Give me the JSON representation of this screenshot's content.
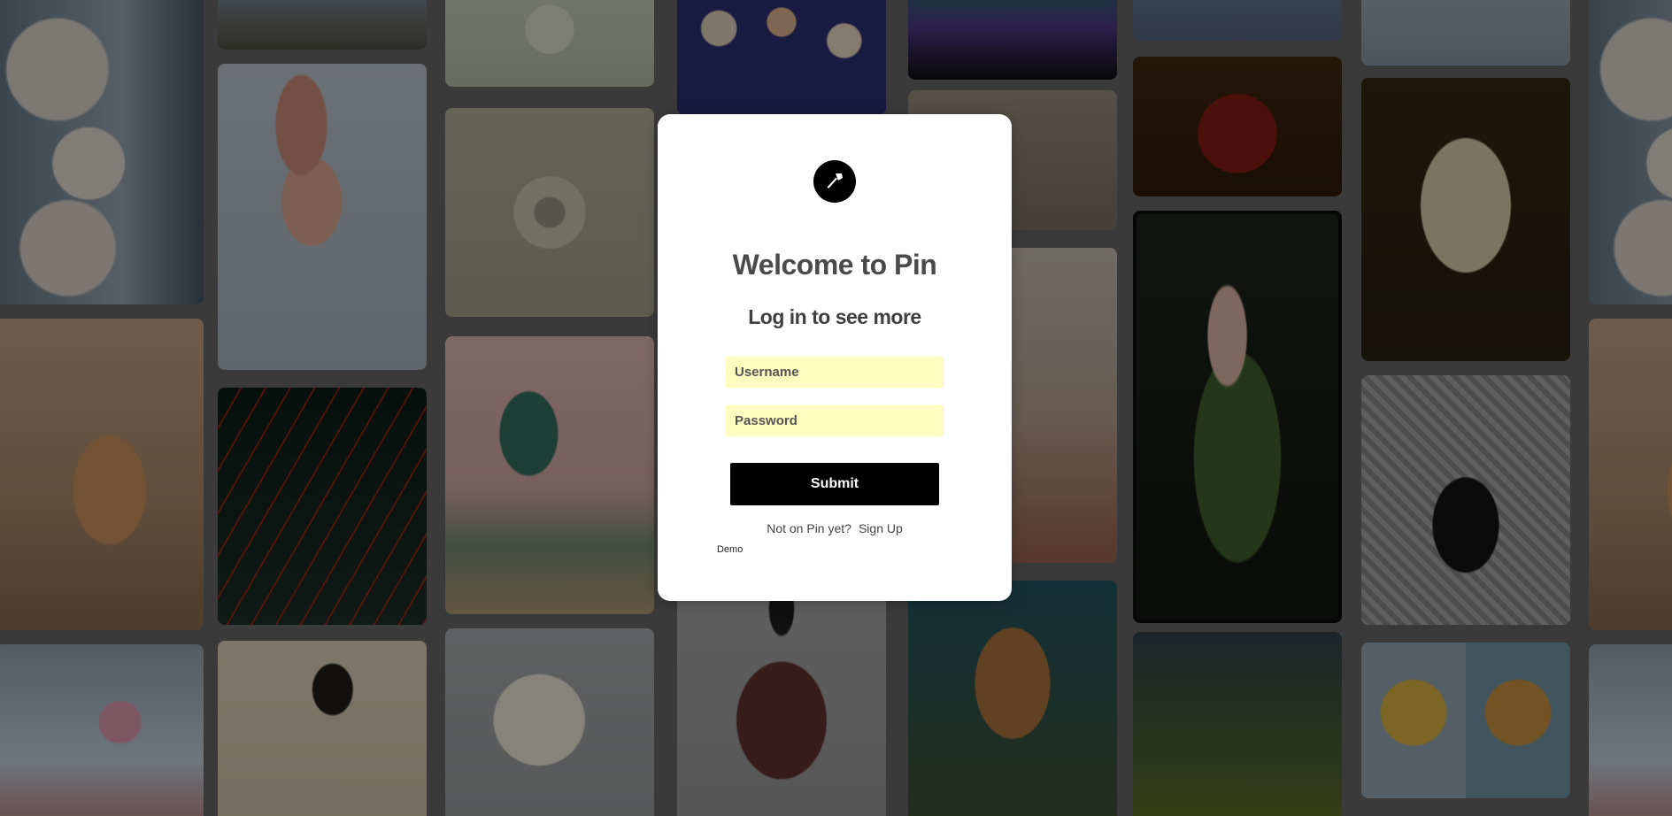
{
  "app": {
    "brand": "Pin"
  },
  "modal": {
    "logo_icon": "pin-hammer-icon",
    "title": "Welcome to Pin",
    "subtitle": "Log in to see more",
    "username_placeholder": "Username",
    "password_placeholder": "Password",
    "submit_label": "Submit",
    "signup_prompt": "Not on Pin yet?",
    "signup_link": "Sign Up",
    "demo_link": "Demo"
  },
  "background": {
    "overlay_color": "#000000",
    "tile_themes": [
      "ice-cream",
      "desert",
      "caracal",
      "drink",
      "horizon",
      "costume",
      "lasers",
      "braid",
      "jewelry",
      "eye",
      "living-room",
      "blonde",
      "bottles",
      "robe",
      "glass-sculpture",
      "studio",
      "bathroom",
      "crown",
      "floor",
      "market",
      "siouxsie-poster",
      "valley",
      "cloth",
      "sculpture",
      "figure",
      "bears"
    ]
  },
  "colors": {
    "accent": "#000000",
    "input_bg": "#fefcbf",
    "title_text": "#4a4a4a"
  }
}
